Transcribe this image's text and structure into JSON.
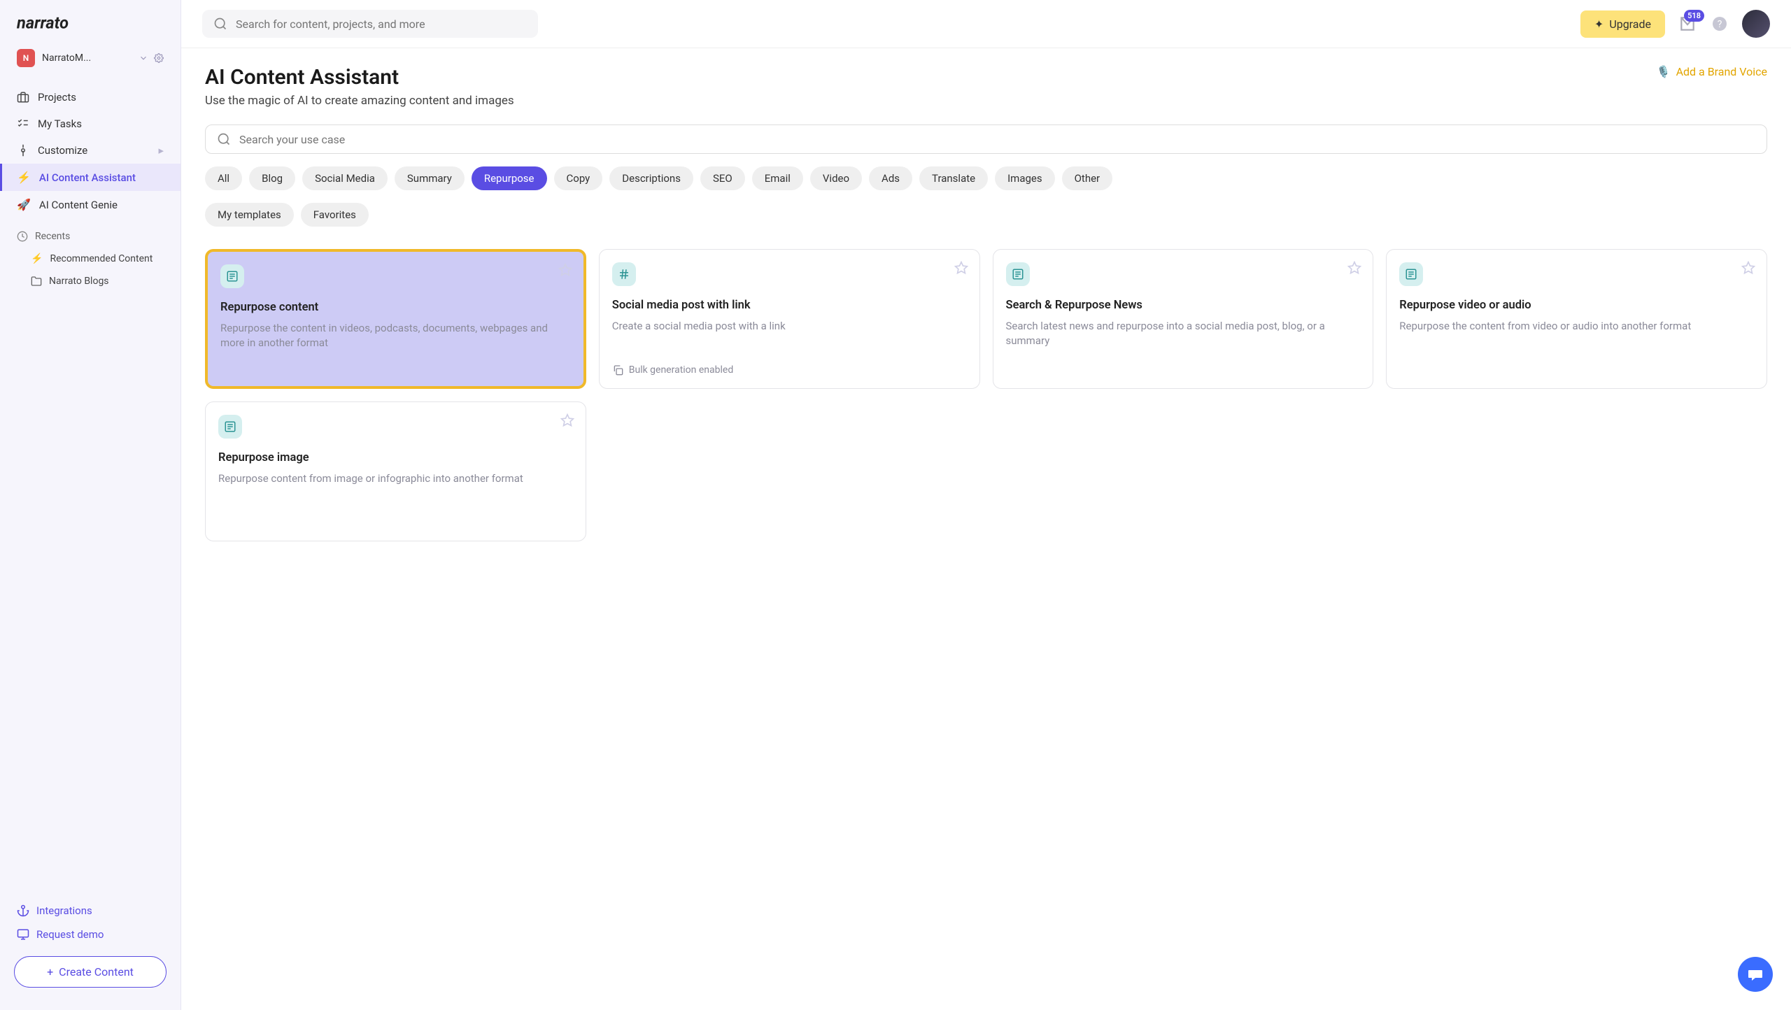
{
  "brand": {
    "name": "narrato"
  },
  "workspace": {
    "initial": "N",
    "name": "NarratoM..."
  },
  "sidebar": {
    "items": [
      {
        "label": "Projects"
      },
      {
        "label": "My Tasks"
      },
      {
        "label": "Customize"
      },
      {
        "label": "AI Content Assistant"
      },
      {
        "label": "AI Content Genie"
      }
    ],
    "recentsHeader": "Recents",
    "recents": [
      {
        "label": "Recommended Content"
      },
      {
        "label": "Narrato Blogs"
      }
    ],
    "bottom": {
      "integrations": "Integrations",
      "requestDemo": "Request demo",
      "create": "Create Content"
    }
  },
  "topbar": {
    "searchPlaceholder": "Search for content, projects, and more",
    "upgrade": "Upgrade",
    "badgeCount": "518"
  },
  "page": {
    "title": "AI Content Assistant",
    "subtitle": "Use the magic of AI to create amazing content and images",
    "brandVoice": "Add a Brand Voice",
    "useCasePlaceholder": "Search your use case"
  },
  "filters": {
    "row1": [
      "All",
      "Blog",
      "Social Media",
      "Summary",
      "Repurpose",
      "Copy",
      "Descriptions",
      "SEO",
      "Email",
      "Video",
      "Ads",
      "Translate",
      "Images",
      "Other"
    ],
    "row2": [
      "My templates",
      "Favorites"
    ],
    "active": "Repurpose"
  },
  "cards": [
    {
      "title": "Repurpose content",
      "desc": "Repurpose the content in videos, podcasts, documents, webpages and more in another format",
      "icon": "news",
      "highlight": true
    },
    {
      "title": "Social media post with link",
      "desc": "Create a social media post with a link",
      "icon": "hash",
      "bulkEnabled": true
    },
    {
      "title": "Search & Repurpose News",
      "desc": "Search latest news and repurpose into a social media post, blog, or a summary",
      "icon": "news"
    },
    {
      "title": "Repurpose video or audio",
      "desc": "Repurpose the content from video or audio into another format",
      "icon": "news"
    },
    {
      "title": "Repurpose image",
      "desc": "Repurpose content from image or infographic into another format",
      "icon": "news"
    }
  ],
  "bulkLabel": "Bulk generation enabled"
}
